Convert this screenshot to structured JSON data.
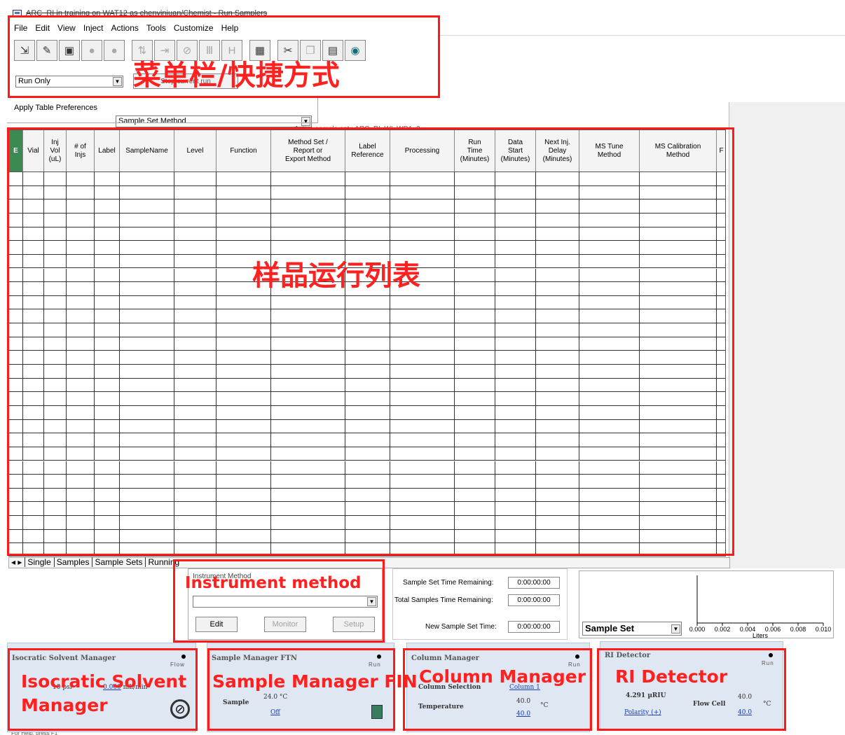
{
  "window": {
    "title": "ARC_RI in training on WAT12 as chenyinjuan/Chemist - Run Samplers"
  },
  "menu": [
    "File",
    "Edit",
    "View",
    "Inject",
    "Actions",
    "Tools",
    "Customize",
    "Help"
  ],
  "toolbar": {
    "icons": [
      "open-sample-set-icon",
      "new-sample-set-icon",
      "save-icon",
      "stop-icon",
      "pause-icon",
      "load-icon",
      "unload-icon",
      "inject-icon",
      "instrument-icon",
      "formula-icon",
      "table-icon",
      "cut-icon",
      "copy-icon",
      "paste-icon",
      "monitor-icon"
    ],
    "glyphs": [
      "⇲",
      "✎",
      "▣",
      "●",
      "●",
      "⇅",
      "⇥",
      "⊘",
      "Ⅲ",
      "H",
      "▦",
      "✂",
      "❐",
      "▤",
      "◉"
    ],
    "run_mode": "Run Only",
    "obscured_button": "Stop current run"
  },
  "preferences": {
    "label": "Apply Table Preferences",
    "value": "Sample Set Method"
  },
  "active_sample_set": "Active sample set : ARC_RI_WI_WD1_2",
  "grid": {
    "columns": [
      "",
      "Vial",
      "Inj\nVol\n(uL)",
      "# of\nInjs",
      "Label",
      "SampleName",
      "Level",
      "Function",
      "Method Set /\nReport or\nExport Method",
      "Label\nReference",
      "Processing",
      "Run\nTime\n(Minutes)",
      "Data\nStart\n(Minutes)",
      "Next Inj.\nDelay\n(Minutes)",
      "MS Tune\nMethod",
      "MS Calibration\nMethod",
      "F"
    ],
    "rows": 28
  },
  "tabs": [
    "Single",
    "Samples",
    "Sample Sets",
    "Running"
  ],
  "instrument": {
    "title": "Instrument Method",
    "edit": "Edit",
    "monitor": "Monitor",
    "setup": "Setup"
  },
  "times": {
    "sample_set_remaining_label": "Sample Set Time Remaining:",
    "sample_set_remaining": "0:00:00:00",
    "total_remaining_label": "Total Samples Time Remaining:",
    "total_remaining": "0:00:00:00",
    "new_set_label": "New Sample Set Time:",
    "new_set": "0:00:00:00"
  },
  "solvent_chart": {
    "selector": "Sample Set",
    "chart_data": {
      "type": "line",
      "x_ticks": [
        "0.000",
        "0.002",
        "0.004",
        "0.006",
        "0.008",
        "0.010"
      ],
      "xlabel": "Liters",
      "series": []
    }
  },
  "panels": {
    "solvent": {
      "title": "Isocratic Solvent Manager",
      "state": "Flow",
      "pressure_value": "10",
      "pressure_unit": "psi",
      "flow_value": "0.000",
      "flow_unit": "mL/min"
    },
    "sample_mgr": {
      "title": "Sample Manager FTN",
      "state": "Run",
      "sample_label": "Sample",
      "temp": "24.0",
      "temp_unit": "°C",
      "setting": "Off"
    },
    "column_mgr": {
      "title": "Column Manager",
      "state": "Run",
      "selection_label": "Column Selection",
      "selection_value": "Column 1",
      "temp_label": "Temperature",
      "temp": "40.0",
      "temp_set": "40.0",
      "unit": "°C"
    },
    "ri": {
      "title": "RI Detector",
      "state": "Run",
      "value": "4.291",
      "unit": "µRIU",
      "flow_cell_label": "Flow Cell",
      "flow_cell_temp": "40.0",
      "flow_cell_set": "40.0",
      "temp_unit": "°C",
      "polarity": "Polarity (+)"
    }
  },
  "annotations": {
    "menu": "菜单栏/快捷方式",
    "list": "样品运行列表",
    "instrument": "Instrument method",
    "solvent": "Isocratic Solvent\nManager",
    "sample": "Sample Manager FIN",
    "column": "Column Manager",
    "ri": "RI Detector"
  },
  "statusbar": "For Help, press F1"
}
